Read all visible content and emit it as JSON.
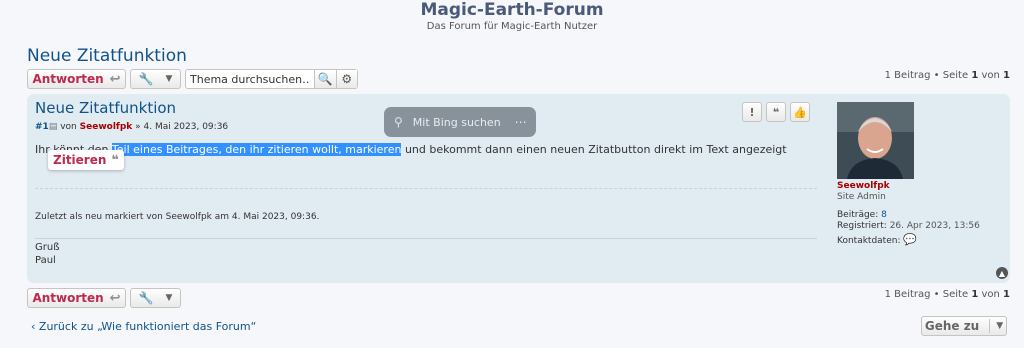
{
  "header": {
    "site_title": "Magic-Earth-Forum",
    "site_desc": "Das Forum für Magic-Earth Nutzer"
  },
  "topic": {
    "title": "Neue Zitatfunktion"
  },
  "actions": {
    "reply_label": "Antworten",
    "search_placeholder": "Thema durchsuchen…",
    "pagination": {
      "count": "1 Beitrag",
      "sep": "•",
      "page_word": "Seite",
      "page": "1",
      "of": "von",
      "total": "1"
    }
  },
  "post": {
    "title": "Neue Zitatfunktion",
    "number": "#1",
    "by": "von",
    "author": "Seewolfpk",
    "date": "» 4. Mai 2023, 09:36",
    "content_before": "Ihr könnt den ",
    "content_selected": "Teil eines Beitrages, den ihr zitieren wollt, markieren",
    "content_after": " und bekommt dann einen neuen Zitatbutton direkt im Text angezeigt",
    "quote_popup_label": "Zitieren",
    "edit_note": "Zuletzt als neu markiert von Seewolfpk am 4. Mai 2023, 09:36.",
    "signature": [
      "Gruß",
      "Paul"
    ]
  },
  "bing_popup": {
    "label": "Mit Bing suchen"
  },
  "profile": {
    "name": "Seewolfpk",
    "rank": "Site Admin",
    "posts_label": "Beiträge:",
    "posts_value": "8",
    "registered_label": "Registriert:",
    "registered_value": "26. Apr 2023, 13:56",
    "contact_label": "Kontaktdaten:"
  },
  "footer": {
    "back_link": "Zurück zu „Wie funktioniert das Forum“",
    "goto_label": "Gehe zu"
  },
  "icons": [
    "reply-icon",
    "wrench-icon",
    "chevron-down-icon",
    "search-icon",
    "gear-icon",
    "file-icon",
    "report-icon",
    "quote-icon",
    "thumbs-up-icon",
    "chat-icon",
    "top-icon",
    "chevron-left-icon"
  ],
  "colors": {
    "link": "#105289",
    "accent": "#bc2a4d",
    "username": "#aa0000",
    "post_bg": "#e1ebf2",
    "selection": "#3390ff"
  }
}
